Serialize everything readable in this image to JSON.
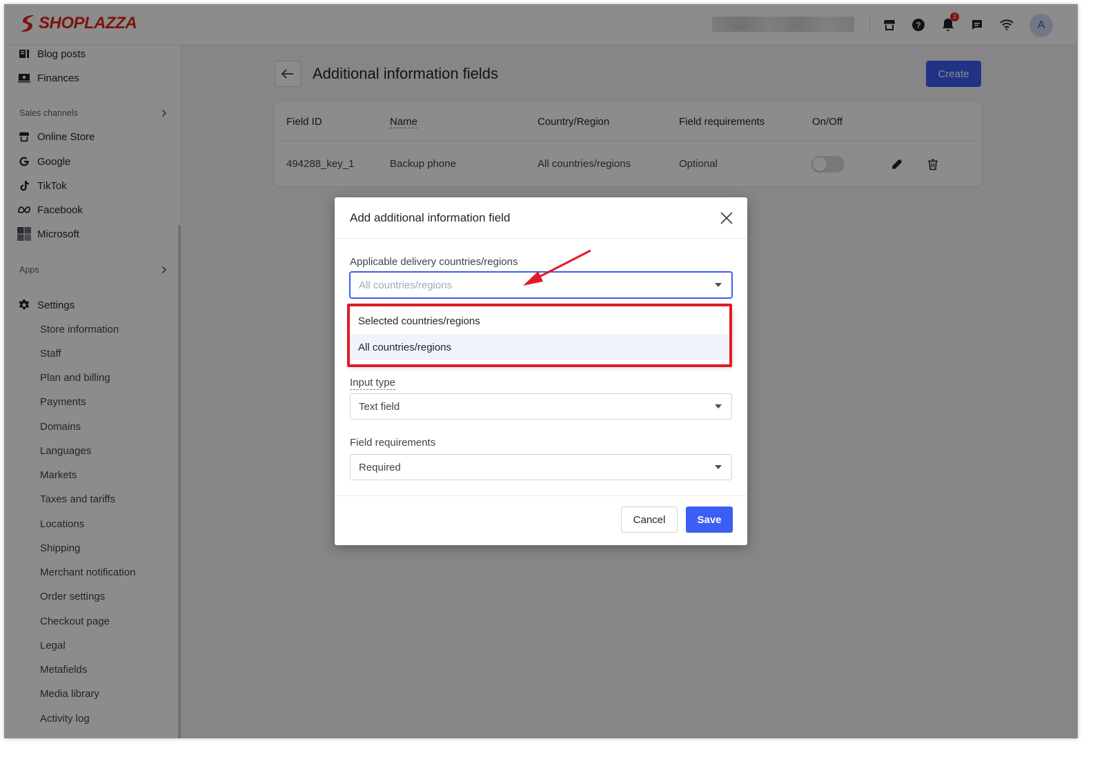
{
  "brand": {
    "name": "SHOPLAZZA",
    "color": "#e0261d"
  },
  "topbar": {
    "icons": [
      "store-icon",
      "help-icon",
      "bell-icon",
      "chat-icon",
      "wifi-icon"
    ],
    "notification_count": "2",
    "avatar_initial": "A"
  },
  "sidebar": {
    "top_items": [
      {
        "label": "Blog posts",
        "icon": "blog-icon"
      },
      {
        "label": "Finances",
        "icon": "finances-icon"
      }
    ],
    "sales_channels_heading": "Sales channels",
    "channels": [
      {
        "label": "Online Store",
        "icon": "store-icon"
      },
      {
        "label": "Google",
        "icon": "google-icon"
      },
      {
        "label": "TikTok",
        "icon": "tiktok-icon"
      },
      {
        "label": "Facebook",
        "icon": "meta-icon"
      },
      {
        "label": "Microsoft",
        "icon": "microsoft-icon"
      }
    ],
    "apps_heading": "Apps",
    "settings_label": "Settings",
    "settings_items": [
      "Store information",
      "Staff",
      "Plan and billing",
      "Payments",
      "Domains",
      "Languages",
      "Markets",
      "Taxes and tariffs",
      "Locations",
      "Shipping",
      "Merchant notification",
      "Order settings",
      "Checkout page",
      "Legal",
      "Metafields",
      "Media library",
      "Activity log"
    ]
  },
  "page": {
    "title": "Additional information fields",
    "create_label": "Create",
    "columns": [
      "Field ID",
      "Name",
      "Country/Region",
      "Field requirements",
      "On/Off"
    ],
    "rows": [
      {
        "field_id": "494288_key_1",
        "name": "Backup phone",
        "country": "All countries/regions",
        "requirement": "Optional",
        "enabled": false
      }
    ]
  },
  "modal": {
    "title": "Add additional information field",
    "countries_label": "Applicable delivery countries/regions",
    "countries_value": "All countries/regions",
    "countries_options": [
      "Selected countries/regions",
      "All countries/regions"
    ],
    "countries_active_option": "All countries/regions",
    "input_type_label": "Input type",
    "input_type_value": "Text field",
    "requirements_label": "Field requirements",
    "requirements_value": "Required",
    "cancel_label": "Cancel",
    "save_label": "Save"
  },
  "colors": {
    "primary": "#3d5ef2",
    "annotation": "#e01b24"
  }
}
